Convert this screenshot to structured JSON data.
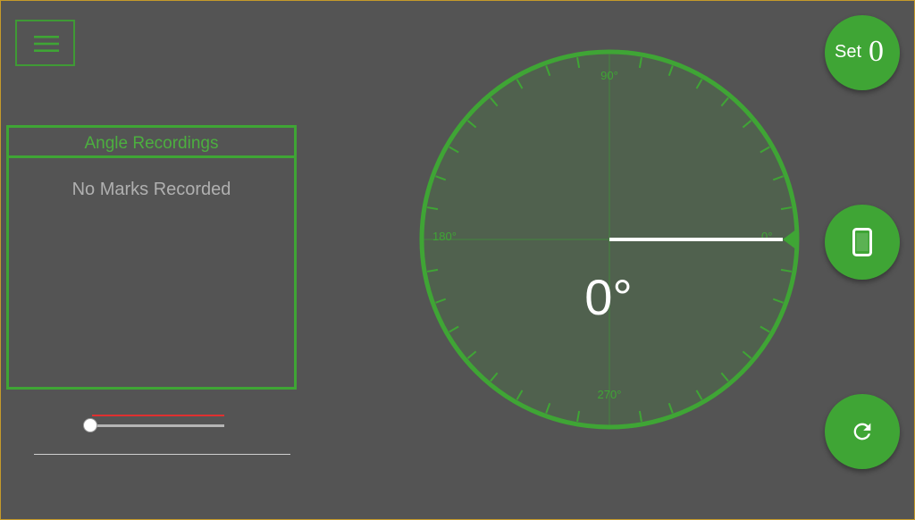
{
  "menu": {
    "icon": "hamburger-menu-icon"
  },
  "recordings": {
    "title": "Angle Recordings",
    "empty_text": "No Marks Recorded"
  },
  "slider": {
    "value": 0
  },
  "dial": {
    "labels": {
      "deg90": "90°",
      "deg180": "180°",
      "deg0": "0°",
      "deg270": "270°"
    },
    "angle": 0,
    "angle_text": "0°",
    "ring_color": "#3fa535",
    "pointer_color": "#ffffff"
  },
  "buttons": {
    "set_zero": {
      "label": "Set",
      "glyph": "0"
    },
    "device_icon": "phone-icon",
    "refresh_icon": "refresh-icon"
  },
  "colors": {
    "background": "#545454",
    "accent": "#3fa535",
    "slider_red": "#e03030"
  }
}
